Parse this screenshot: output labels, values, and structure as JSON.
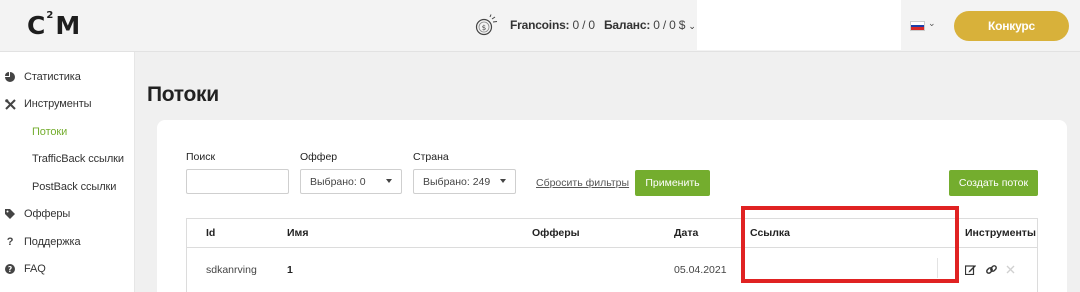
{
  "header": {
    "logo_c": "C",
    "logo_sup": "2",
    "logo_m": "M",
    "francoins_label": "Francoins:",
    "francoins_value": "0 / 0",
    "balance_label": "Баланс:",
    "balance_value": "0 / 0 $",
    "contest_button": "Конкурс",
    "flag_colors": [
      "#ffffff",
      "#1c3fa8",
      "#d72828"
    ]
  },
  "sidebar": {
    "items": [
      {
        "label": "Статистика",
        "icon": "pie-chart-icon"
      },
      {
        "label": "Инструменты",
        "icon": "tools-icon"
      }
    ],
    "sub_items": [
      {
        "label": "Потоки",
        "active": true
      },
      {
        "label": "TrafficBack ссылки",
        "active": false
      },
      {
        "label": "PostBack ссылки",
        "active": false
      }
    ],
    "bottom_items": [
      {
        "label": "Офферы",
        "icon": "tag-icon"
      },
      {
        "label": "Поддержка",
        "icon": "question-icon"
      },
      {
        "label": "FAQ",
        "icon": "help-circle-icon"
      }
    ]
  },
  "main": {
    "title": "Потоки",
    "filters": {
      "search_label": "Поиск",
      "search_value": "",
      "offer_label": "Оффер",
      "offer_value": "Выбрано: 0",
      "country_label": "Страна",
      "country_value": "Выбрано: 249",
      "reset_link": "Сбросить фильтры",
      "apply_button": "Применить",
      "create_button": "Создать поток"
    },
    "table": {
      "headers": [
        "Id",
        "Имя",
        "Офферы",
        "Дата",
        "Ссылка",
        "Инструменты"
      ],
      "rows": [
        {
          "id": "sdkanrving",
          "name": "1",
          "offers": "",
          "date": "05.04.2021",
          "link": ""
        }
      ]
    }
  },
  "colors": {
    "accent_green": "#74ad2e",
    "contest_gold": "#d8b13a",
    "highlight_red": "#e02222"
  }
}
